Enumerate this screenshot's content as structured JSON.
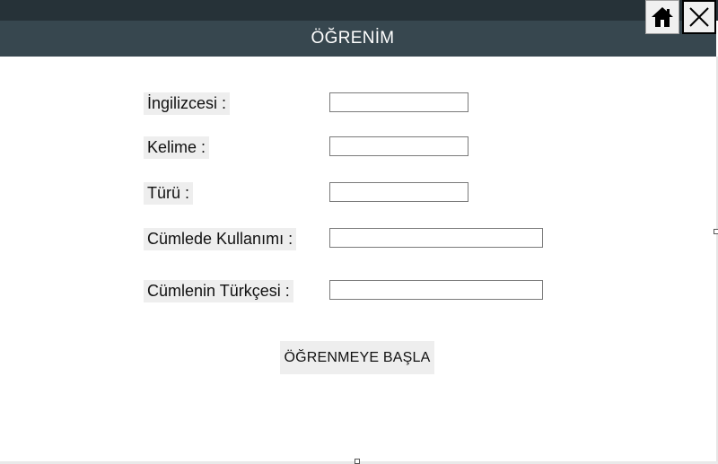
{
  "window": {
    "title": "ÖĞRENİM",
    "home_icon": "home-icon",
    "close_icon": "close-icon"
  },
  "form": {
    "fields": [
      {
        "label": "İngilizcesi :",
        "value": ""
      },
      {
        "label": "Kelime :",
        "value": ""
      },
      {
        "label": "Türü :",
        "value": ""
      },
      {
        "label": "Cümlede Kullanımı :",
        "value": ""
      },
      {
        "label": "Cümlenin Türkçesi :",
        "value": ""
      }
    ],
    "start_button_label": "ÖĞRENMEYE BAŞLA"
  },
  "colors": {
    "top_strip": "#263238",
    "title_bar": "#37474f",
    "title_text": "#ffffff",
    "label_bg": "#eeeeee"
  }
}
